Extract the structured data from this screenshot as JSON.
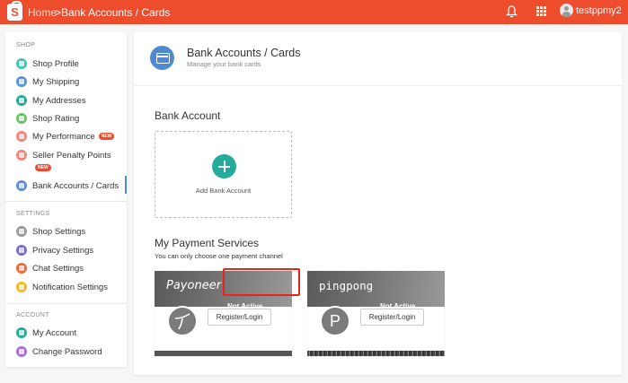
{
  "topbar": {
    "logo_letter": "S",
    "breadcrumb_home": "Home",
    "breadcrumb_separator": ">",
    "breadcrumb_current": "Bank Accounts / Cards",
    "username": "testppmy2",
    "icons": [
      "bell-icon",
      "apps-grid-icon",
      "user-avatar-icon"
    ],
    "brand_color": "#ee4d2d"
  },
  "sidebar": {
    "sections": [
      {
        "title": "SHOP",
        "items": [
          {
            "label": "Shop Profile",
            "icon": "shop-profile-icon",
            "color": "#40c4b4"
          },
          {
            "label": "My Shipping",
            "icon": "shipping-icon",
            "color": "#5b8fd6"
          },
          {
            "label": "My Addresses",
            "icon": "address-icon",
            "color": "#26aa99"
          },
          {
            "label": "Shop Rating",
            "icon": "star-icon",
            "color": "#6cc067"
          },
          {
            "label": "My Performance",
            "icon": "performance-icon",
            "color": "#f3857a",
            "badge": "NEW"
          },
          {
            "label": "Seller Penalty Points",
            "icon": "penalty-icon",
            "color": "#f3857a",
            "badge": "NEW"
          },
          {
            "label": "Bank Accounts / Cards",
            "icon": "bank-card-icon",
            "color": "#5b8fd6",
            "active": true
          }
        ]
      },
      {
        "title": "SETTINGS",
        "items": [
          {
            "label": "Shop Settings",
            "icon": "gear-icon",
            "color": "#9a9a9a"
          },
          {
            "label": "Privacy Settings",
            "icon": "privacy-icon",
            "color": "#7a6fd0"
          },
          {
            "label": "Chat Settings",
            "icon": "chat-icon",
            "color": "#ee6a3a"
          },
          {
            "label": "Notification Settings",
            "icon": "notification-icon",
            "color": "#f5b922"
          }
        ]
      },
      {
        "title": "ACCOUNT",
        "items": [
          {
            "label": "My Account",
            "icon": "account-icon",
            "color": "#26aa99"
          },
          {
            "label": "Change Password",
            "icon": "key-icon",
            "color": "#a86ed8"
          }
        ]
      }
    ]
  },
  "main": {
    "header_title": "Bank Accounts / Cards",
    "header_subtitle": "Manage your bank cards",
    "bank_section_title": "Bank Account",
    "add_bank_label": "Add Bank Account",
    "payment_section_title": "My Payment Services",
    "payment_section_subtitle": "You can only choose one payment channel",
    "payment_services": [
      {
        "brand": "Payoneer",
        "status": "Not Active",
        "button": "Register/Login",
        "logo_glyph": "Y"
      },
      {
        "brand": "pingpong",
        "status": "Not Active",
        "button": "Register/Login",
        "logo_glyph": "P"
      }
    ]
  }
}
